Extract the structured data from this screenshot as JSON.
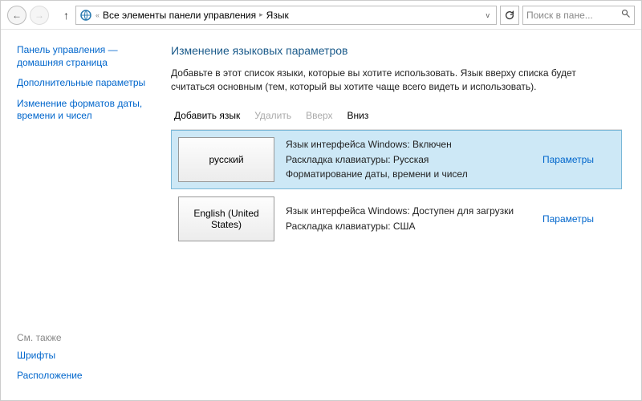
{
  "breadcrumb": {
    "prefix": "«",
    "item1": "Все элементы панели управления",
    "item2": "Язык"
  },
  "search": {
    "placeholder": "Поиск в пане..."
  },
  "sidebar": {
    "home": "Панель управления — домашняя страница",
    "advanced": "Дополнительные параметры",
    "formats": "Изменение форматов даты, времени и чисел",
    "see_also": "См. также",
    "fonts": "Шрифты",
    "location": "Расположение"
  },
  "main": {
    "title": "Изменение языковых параметров",
    "desc": "Добавьте в этот список языки, которые вы хотите использовать. Язык вверху списка будет считаться основным (тем, который вы хотите чаще всего видеть и использовать)."
  },
  "toolbar": {
    "add": "Добавить язык",
    "remove": "Удалить",
    "up": "Вверх",
    "down": "Вниз"
  },
  "langs": [
    {
      "name": "русский",
      "line1": "Язык интерфейса Windows: Включен",
      "line2": "Раскладка клавиатуры: Русская",
      "line3": "Форматирование даты, времени и чисел",
      "options": "Параметры"
    },
    {
      "name": "English (United States)",
      "line1": "Язык интерфейса Windows: Доступен для загрузки",
      "line2": "Раскладка клавиатуры: США",
      "line3": "",
      "options": "Параметры"
    }
  ]
}
